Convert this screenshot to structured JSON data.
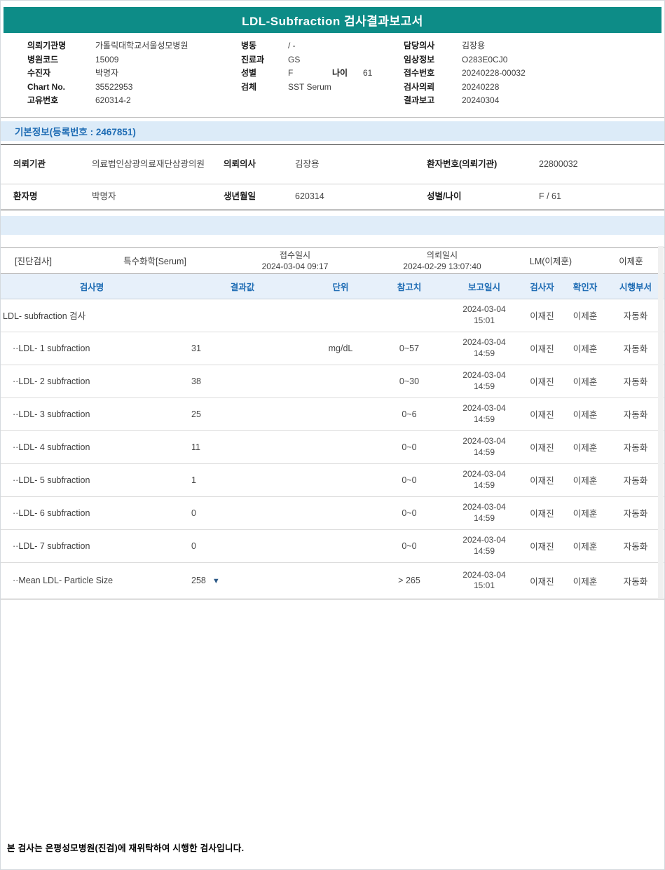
{
  "colors": {
    "teal": "#0d8c87",
    "blue": "#1e6cb4",
    "light_blue_bg": "#dcebf8",
    "low_flag": "#2c5a87"
  },
  "title": "LDL-Subfraction 검사결과보고서",
  "header_info": {
    "left": [
      {
        "label": "의뢰기관명",
        "value": "가톨릭대학교서울성모병원"
      },
      {
        "label": "병원코드",
        "value": "15009"
      },
      {
        "label": "수진자",
        "value": "박명자"
      },
      {
        "label": "Chart No.",
        "value": "35522953"
      },
      {
        "label": "고유번호",
        "value": "620314-2"
      }
    ],
    "middle": [
      {
        "label": "병동",
        "value": "/ -"
      },
      {
        "label": "진료과",
        "value": "GS"
      },
      {
        "label": "성별",
        "value": "F",
        "label2": "나이",
        "value2": "61"
      },
      {
        "label": "검체",
        "value": "SST Serum"
      }
    ],
    "right": [
      {
        "label": "담당의사",
        "value": "김장용"
      },
      {
        "label": "임상정보",
        "value": "O283E0CJ0"
      },
      {
        "label": "접수번호",
        "value": "20240228-00032"
      },
      {
        "label": "검사의뢰",
        "value": "20240228"
      },
      {
        "label": "결과보고",
        "value": "20240304"
      }
    ]
  },
  "basic_info": {
    "section_title": "기본정보(등록번호 : 2467851)",
    "row1": {
      "label1": "의뢰기관",
      "value1": "의료법인삼광의료재단삼광의원",
      "label2": "의뢰의사",
      "value2": "김장용",
      "label3": "환자번호(의뢰기관)",
      "value3": "22800032"
    },
    "row2": {
      "label1": "환자명",
      "value1": "박명자",
      "label2": "생년월일",
      "value2": "620314",
      "label3": "성별/나이",
      "value3": "F / 61"
    }
  },
  "exam_meta": {
    "category": "[진단검사]",
    "panel": "특수화학[Serum]",
    "receipt_label": "접수일시",
    "receipt_datetime": "2024-03-04 09:17",
    "request_label": "의뢰일시",
    "request_datetime": "2024-02-29 13:07:40",
    "lab": "LM(이제훈)",
    "reporter": "이제훈"
  },
  "results": {
    "headers": [
      "검사명",
      "결과값",
      "단위",
      "참고치",
      "보고일시",
      "검사자",
      "확인자",
      "시행부서"
    ],
    "rows": [
      {
        "name": "LDL- subfraction 검사",
        "result": "",
        "flag": "",
        "unit": "",
        "ref": "",
        "date": "2024-03-04",
        "time": "15:01",
        "tester": "이재진",
        "confirmer": "이제훈",
        "dept": "자동화"
      },
      {
        "name": "··LDL- 1 subfraction",
        "result": "31",
        "flag": "",
        "unit": "mg/dL",
        "ref": "0~57",
        "date": "2024-03-04",
        "time": "14:59",
        "tester": "이재진",
        "confirmer": "이제훈",
        "dept": "자동화"
      },
      {
        "name": "··LDL- 2 subfraction",
        "result": "38",
        "flag": "",
        "unit": "",
        "ref": "0~30",
        "date": "2024-03-04",
        "time": "14:59",
        "tester": "이재진",
        "confirmer": "이제훈",
        "dept": "자동화"
      },
      {
        "name": "··LDL- 3 subfraction",
        "result": "25",
        "flag": "",
        "unit": "",
        "ref": "0~6",
        "date": "2024-03-04",
        "time": "14:59",
        "tester": "이재진",
        "confirmer": "이제훈",
        "dept": "자동화"
      },
      {
        "name": "··LDL- 4 subfraction",
        "result": "11",
        "flag": "",
        "unit": "",
        "ref": "0~0",
        "date": "2024-03-04",
        "time": "14:59",
        "tester": "이재진",
        "confirmer": "이제훈",
        "dept": "자동화"
      },
      {
        "name": "··LDL- 5 subfraction",
        "result": "1",
        "flag": "",
        "unit": "",
        "ref": "0~0",
        "date": "2024-03-04",
        "time": "14:59",
        "tester": "이재진",
        "confirmer": "이제훈",
        "dept": "자동화"
      },
      {
        "name": "··LDL- 6 subfraction",
        "result": "0",
        "flag": "",
        "unit": "",
        "ref": "0~0",
        "date": "2024-03-04",
        "time": "14:59",
        "tester": "이재진",
        "confirmer": "이제훈",
        "dept": "자동화"
      },
      {
        "name": "··LDL- 7 subfraction",
        "result": "0",
        "flag": "",
        "unit": "",
        "ref": "0~0",
        "date": "2024-03-04",
        "time": "14:59",
        "tester": "이재진",
        "confirmer": "이제훈",
        "dept": "자동화"
      },
      {
        "name": "··Mean LDL- Particle Size",
        "result": "258",
        "flag": "▼",
        "unit": "",
        "ref": "> 265",
        "date": "2024-03-04",
        "time": "15:01",
        "tester": "이재진",
        "confirmer": "이제훈",
        "dept": "자동화"
      }
    ]
  },
  "footer_note": "본 검사는 은평성모병원(진검)에 재위탁하여 시행한 검사입니다."
}
